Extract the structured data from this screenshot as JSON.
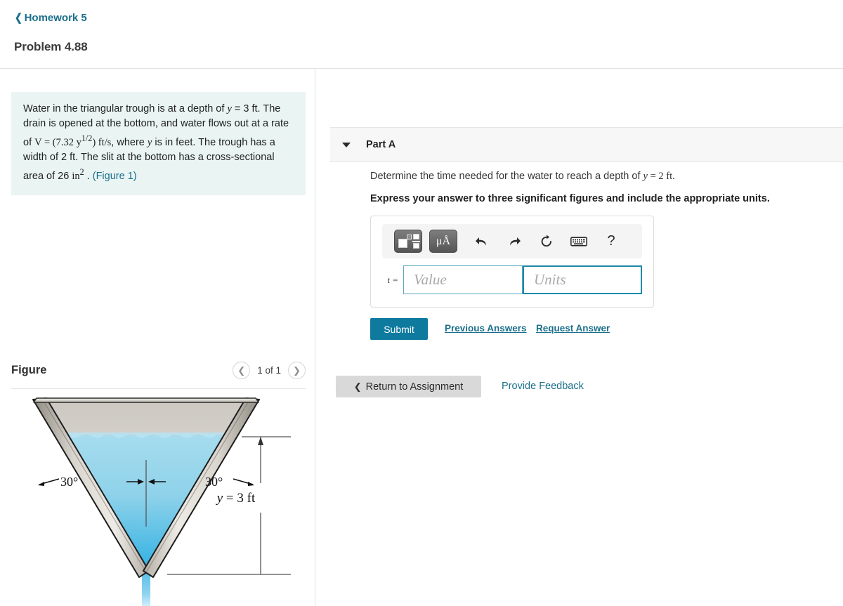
{
  "header": {
    "breadcrumb_label": "Homework 5",
    "breadcrumb_icon": "chevron-left-icon",
    "page_title": "Problem 4.88"
  },
  "problem": {
    "line1_a": "Water in the triangular trough is at a depth of ",
    "line1_y": "y",
    "line1_b": " = 3 ft.",
    "line2": "The drain is opened at the bottom, and water flows out at a rate of ",
    "rate_V": "V",
    "rate_eq": " = ",
    "rate_expr": "(7.32 y",
    "rate_exp": "1/2",
    "rate_close": ") ft/s",
    "line3_a": ", where ",
    "line3_y": "y",
    "line3_b": " is in feet. The trough has a width of 2 ft. The slit at the bottom has a cross-sectional area of 26 ",
    "area_unit": "in",
    "area_exp": "2",
    "line3_c": " . ",
    "figure_link": "(Figure 1)"
  },
  "figure": {
    "title": "Figure",
    "prev_icon": "chevron-left-icon",
    "next_icon": "chevron-right-icon",
    "counter": "1 of 1",
    "angle_left": "30°",
    "angle_right": "30°",
    "depth_label_y": "y",
    "depth_label_eq": " = 3 ft",
    "colors": {
      "water_top": "#9ed9ed",
      "water_bottom": "#33b0e0",
      "metal_light": "#e6e2db",
      "metal_dark": "#9c968c",
      "interior": "#bdb8b0"
    }
  },
  "part_a": {
    "caret_icon": "caret-down-icon",
    "label": "Part A",
    "question_a": "Determine the time needed for the water to reach a depth of ",
    "question_y": "y",
    "question_b": " = 2 ft.",
    "instruction": "Express your answer to three significant figures and include the appropriate units."
  },
  "answer_widget": {
    "toolbar": [
      {
        "name": "math-template-button",
        "icon": "template-boxes-icon",
        "label": ""
      },
      {
        "name": "units-button",
        "icon": "mu-angstrom-icon",
        "label": "μÅ"
      },
      {
        "name": "undo-button",
        "icon": "undo-arrow-icon",
        "label": ""
      },
      {
        "name": "redo-button",
        "icon": "redo-arrow-icon",
        "label": ""
      },
      {
        "name": "reset-button",
        "icon": "refresh-circle-icon",
        "label": ""
      },
      {
        "name": "keyboard-button",
        "icon": "keyboard-icon",
        "label": ""
      },
      {
        "name": "help-button",
        "icon": "question-mark-icon",
        "label": "?"
      }
    ],
    "variable_label": "t =",
    "value_placeholder": "Value",
    "units_placeholder": "Units",
    "value_current": "",
    "units_current": ""
  },
  "actions": {
    "submit_label": "Submit",
    "previous_answers_label": "Previous Answers",
    "request_answer_label": "Request Answer",
    "return_label": "Return to Assignment",
    "return_icon": "chevron-left-icon",
    "feedback_label": "Provide Feedback"
  },
  "colors": {
    "accent_teal": "#0d7a9e",
    "link_blue": "#1b6f8c",
    "problem_bg": "#e9f4f3",
    "part_header_bg": "#f7f7f7"
  }
}
